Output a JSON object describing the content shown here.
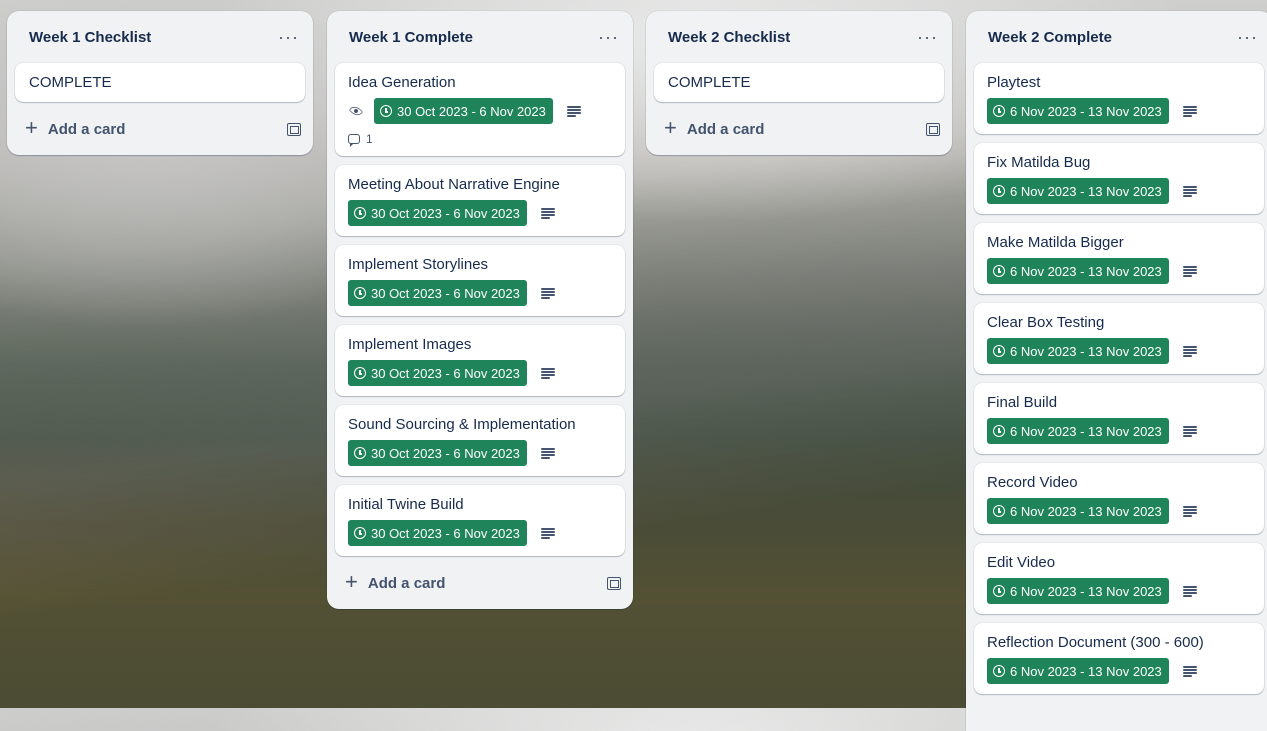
{
  "lists": [
    {
      "title": "Week 1 Checklist",
      "menu": "···",
      "cards": [
        {
          "title": "COMPLETE"
        }
      ],
      "add_label": "Add a card"
    },
    {
      "title": "Week 1 Complete",
      "menu": "···",
      "cards": [
        {
          "title": "Idea Generation",
          "date": "30 Oct 2023 - 6 Nov 2023",
          "comments": "1",
          "watching": true
        },
        {
          "title": "Meeting About Narrative Engine",
          "date": "30 Oct 2023 - 6 Nov 2023"
        },
        {
          "title": "Implement Storylines",
          "date": "30 Oct 2023 - 6 Nov 2023"
        },
        {
          "title": "Implement Images",
          "date": "30 Oct 2023 - 6 Nov 2023"
        },
        {
          "title": "Sound Sourcing & Implementation",
          "date": "30 Oct 2023 - 6 Nov 2023"
        },
        {
          "title": "Initial Twine Build",
          "date": "30 Oct 2023 - 6 Nov 2023"
        }
      ],
      "add_label": "Add a card"
    },
    {
      "title": "Week 2 Checklist",
      "menu": "···",
      "cards": [
        {
          "title": "COMPLETE"
        }
      ],
      "add_label": "Add a card"
    },
    {
      "title": "Week 2 Complete",
      "menu": "···",
      "cards": [
        {
          "title": "Playtest",
          "date": "6 Nov 2023 - 13 Nov 2023"
        },
        {
          "title": "Fix Matilda Bug",
          "date": "6 Nov 2023 - 13 Nov 2023"
        },
        {
          "title": "Make Matilda Bigger",
          "date": "6 Nov 2023 - 13 Nov 2023"
        },
        {
          "title": "Clear Box Testing",
          "date": "6 Nov 2023 - 13 Nov 2023"
        },
        {
          "title": "Final Build",
          "date": "6 Nov 2023 - 13 Nov 2023"
        },
        {
          "title": "Record Video",
          "date": "6 Nov 2023 - 13 Nov 2023"
        },
        {
          "title": "Edit Video",
          "date": "6 Nov 2023 - 13 Nov 2023"
        },
        {
          "title": "Reflection Document (300 - 600)",
          "date": "6 Nov 2023 - 13 Nov 2023"
        }
      ]
    }
  ],
  "colors": {
    "date_badge": "#1f845a",
    "list_bg": "#f1f2f4",
    "title_text": "#172b4d"
  },
  "icons": [
    "clock-icon",
    "description-icon",
    "eye-icon",
    "comment-icon",
    "plus-icon",
    "template-icon",
    "more-icon"
  ]
}
